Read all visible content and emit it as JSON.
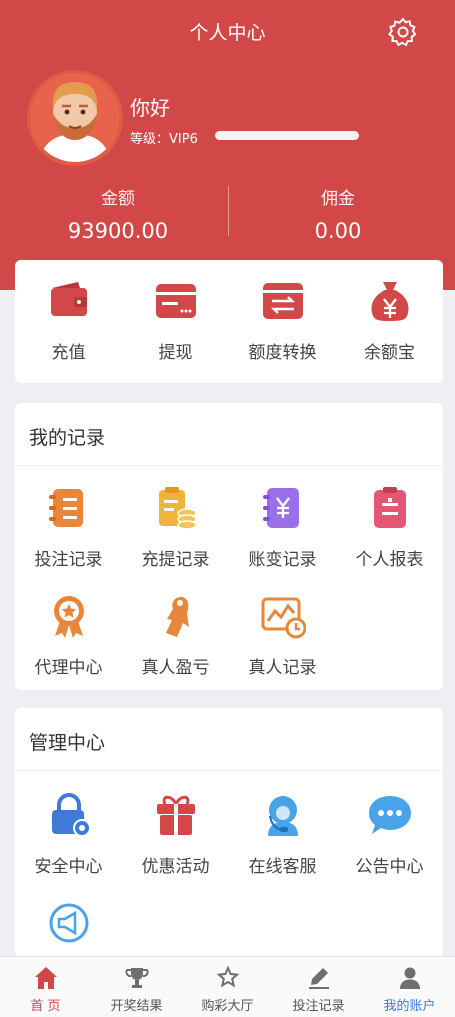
{
  "header": {
    "title": "个人中心",
    "settings_icon": "gear-icon"
  },
  "profile": {
    "greeting": "你好",
    "level_label": "等级：",
    "level_value": "VIP6",
    "level_progress": 1.0
  },
  "stats": {
    "balance": {
      "label": "金额",
      "value": "93900.00"
    },
    "commission": {
      "label": "佣金",
      "value": "0.00"
    }
  },
  "actions": [
    {
      "label": "充值",
      "icon": "wallet-icon"
    },
    {
      "label": "提现",
      "icon": "card-withdraw-icon"
    },
    {
      "label": "额度转换",
      "icon": "transfer-icon"
    },
    {
      "label": "余额宝",
      "icon": "money-bag-icon"
    }
  ],
  "records": {
    "title": "我的记录",
    "items": [
      {
        "label": "投注记录",
        "icon": "bet-record-icon"
      },
      {
        "label": "充提记录",
        "icon": "deposit-record-icon"
      },
      {
        "label": "账变记录",
        "icon": "account-change-icon"
      },
      {
        "label": "个人报表",
        "icon": "report-icon"
      },
      {
        "label": "代理中心",
        "icon": "medal-icon"
      },
      {
        "label": "真人盈亏",
        "icon": "live-dealer-icon"
      },
      {
        "label": "真人记录",
        "icon": "chart-clock-icon"
      }
    ]
  },
  "management": {
    "title": "管理中心",
    "items": [
      {
        "label": "安全中心",
        "icon": "lock-icon"
      },
      {
        "label": "优惠活动",
        "icon": "gift-icon"
      },
      {
        "label": "在线客服",
        "icon": "customer-service-icon"
      },
      {
        "label": "公告中心",
        "icon": "chat-bubble-icon"
      },
      {
        "label": "",
        "icon": "megaphone-icon"
      }
    ]
  },
  "tabbar": [
    {
      "label": "首 页",
      "icon": "home-icon",
      "active": true
    },
    {
      "label": "开奖结果",
      "icon": "trophy-icon"
    },
    {
      "label": "购彩大厅",
      "icon": "star-icon"
    },
    {
      "label": "投注记录",
      "icon": "edit-icon"
    },
    {
      "label": "我的账户",
      "icon": "user-icon"
    }
  ],
  "colors": {
    "brand_red": "#d24848",
    "orange": "#e8863a",
    "yellow": "#f2b33a",
    "purple": "#9b6fe8",
    "pink": "#e55574",
    "blue": "#3e7ad6",
    "light_blue": "#4aa3e8"
  }
}
